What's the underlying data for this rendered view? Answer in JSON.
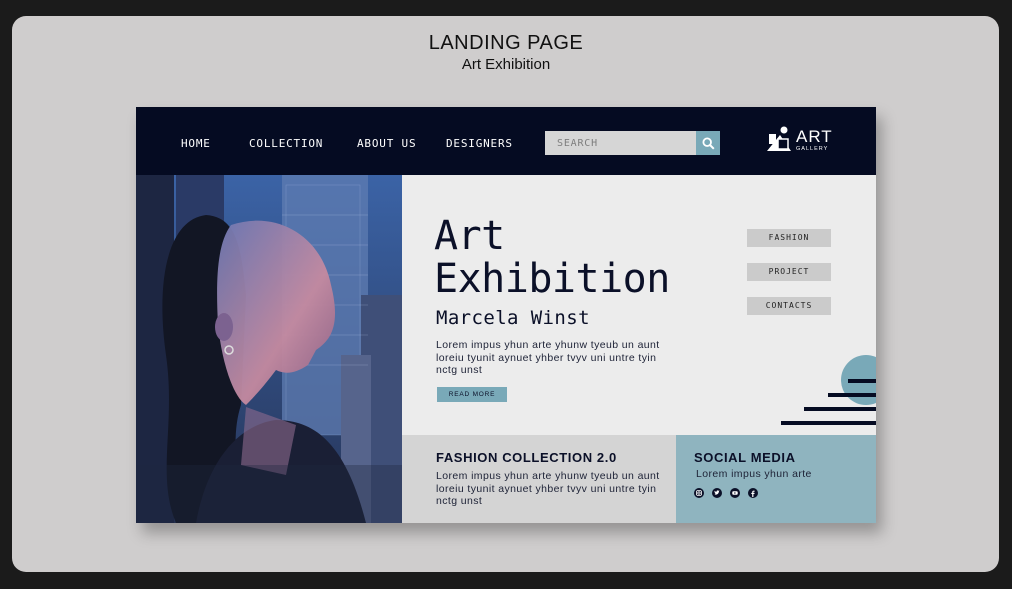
{
  "heading": {
    "title": "LANDING PAGE",
    "subtitle": "Art Exhibition"
  },
  "nav": {
    "items": [
      "HOME",
      "COLLECTION",
      "ABOUT US",
      "DESIGNERS"
    ],
    "search_placeholder": "SEARCH",
    "logo_text": "ART",
    "logo_sub": "GALLERY"
  },
  "hero": {
    "title_line1": "Art",
    "title_line2": "Exhibition",
    "artist": "Marcela Winst",
    "body": "Lorem impus yhun arte yhunw tyeub un aunt loreiu tyunit aynuet yhber tvyv uni untre tyin nctg unst",
    "read_more": "READ MORE"
  },
  "side_menu": [
    "FASHION",
    "PROJECT",
    "CONTACTS"
  ],
  "fashion": {
    "title": "FASHION COLLECTION 2.0",
    "body": "Lorem impus yhun arte yhunw tyeub un aunt loreiu tyunit aynuet yhber tvyv uni untre tyin nctg unst"
  },
  "social": {
    "title": "SOCIAL MEDIA",
    "body": "Lorem impus yhun arte",
    "icons": [
      "instagram-icon",
      "twitter-icon",
      "youtube-icon",
      "facebook-icon"
    ]
  },
  "colors": {
    "navy": "#050b22",
    "teal": "#79a9b8",
    "panel_teal": "#8fb4bf",
    "hero_bg": "#ececec"
  }
}
